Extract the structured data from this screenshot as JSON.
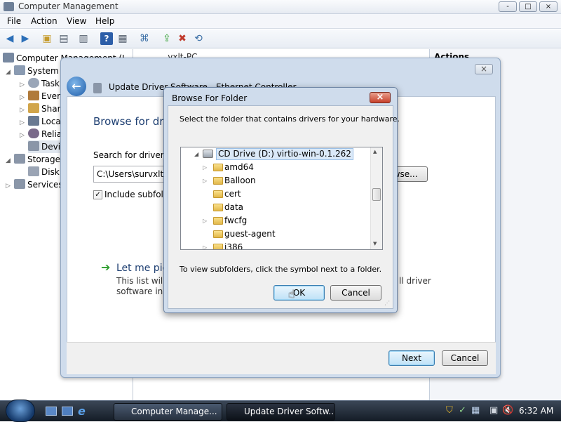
{
  "main_window": {
    "title": "Computer Management",
    "caption_buttons": {
      "minimize": "-",
      "maximize": "□",
      "close": "×"
    },
    "menu": [
      "File",
      "Action",
      "View",
      "Help"
    ],
    "toolbar_icons": [
      "back-icon",
      "forward-icon",
      "up-folder-icon",
      "show-hide-tree-icon",
      "export-list-icon",
      "help-icon",
      "show-action-pane-icon",
      "scan-hardware-icon",
      "update-driver-icon",
      "disable-device-icon",
      "uninstall-device-icon"
    ],
    "tree": {
      "root": "Computer Management (L",
      "system": "System",
      "system_items": [
        "Task",
        "Ever",
        "Shar",
        "Loca",
        "Relia",
        "Devi"
      ],
      "storage": "Storage",
      "storage_items": [
        "Disk"
      ],
      "services": "Services"
    },
    "middle_header": "... vxlt-PC",
    "right_header": "Actions"
  },
  "wizard": {
    "title": "Update Driver Software - Ethernet Controller",
    "close_glyph": "×",
    "heading": "Browse for driv",
    "search_label": "Search for driver so",
    "path_value": "C:\\Users\\survxlt\\D",
    "browse_button": "Browse...",
    "include_subfolders": "Include subfolde",
    "let_me_pick": "Let me pic",
    "desc_line1": "This list will s",
    "desc_line1_end": "ll driver",
    "desc_line2": "software in t",
    "next_button": "Next",
    "cancel_button": "Cancel"
  },
  "browse_dialog": {
    "title": "Browse For Folder",
    "close_glyph": "×",
    "instruction": "Select the folder that contains drivers for your hardware.",
    "root_item": "CD Drive (D:) virtio-win-0.1.262",
    "folders": [
      {
        "name": "amd64",
        "expandable": true
      },
      {
        "name": "Balloon",
        "expandable": true
      },
      {
        "name": "cert",
        "expandable": false
      },
      {
        "name": "data",
        "expandable": false
      },
      {
        "name": "fwcfg",
        "expandable": true
      },
      {
        "name": "guest-agent",
        "expandable": false
      },
      {
        "name": "i386",
        "expandable": true
      }
    ],
    "hint": "To view subfolders, click the symbol next to a folder.",
    "ok_button": "OK",
    "cancel_button": "Cancel"
  },
  "taskbar": {
    "tasks": [
      "Computer Manage...",
      "Update Driver Softw..."
    ],
    "clock": "6:32 AM"
  },
  "colors": {
    "accent_blue": "#1f4e8c",
    "heading_blue": "#1e3f72",
    "arrow_green": "#2e9e2e"
  }
}
